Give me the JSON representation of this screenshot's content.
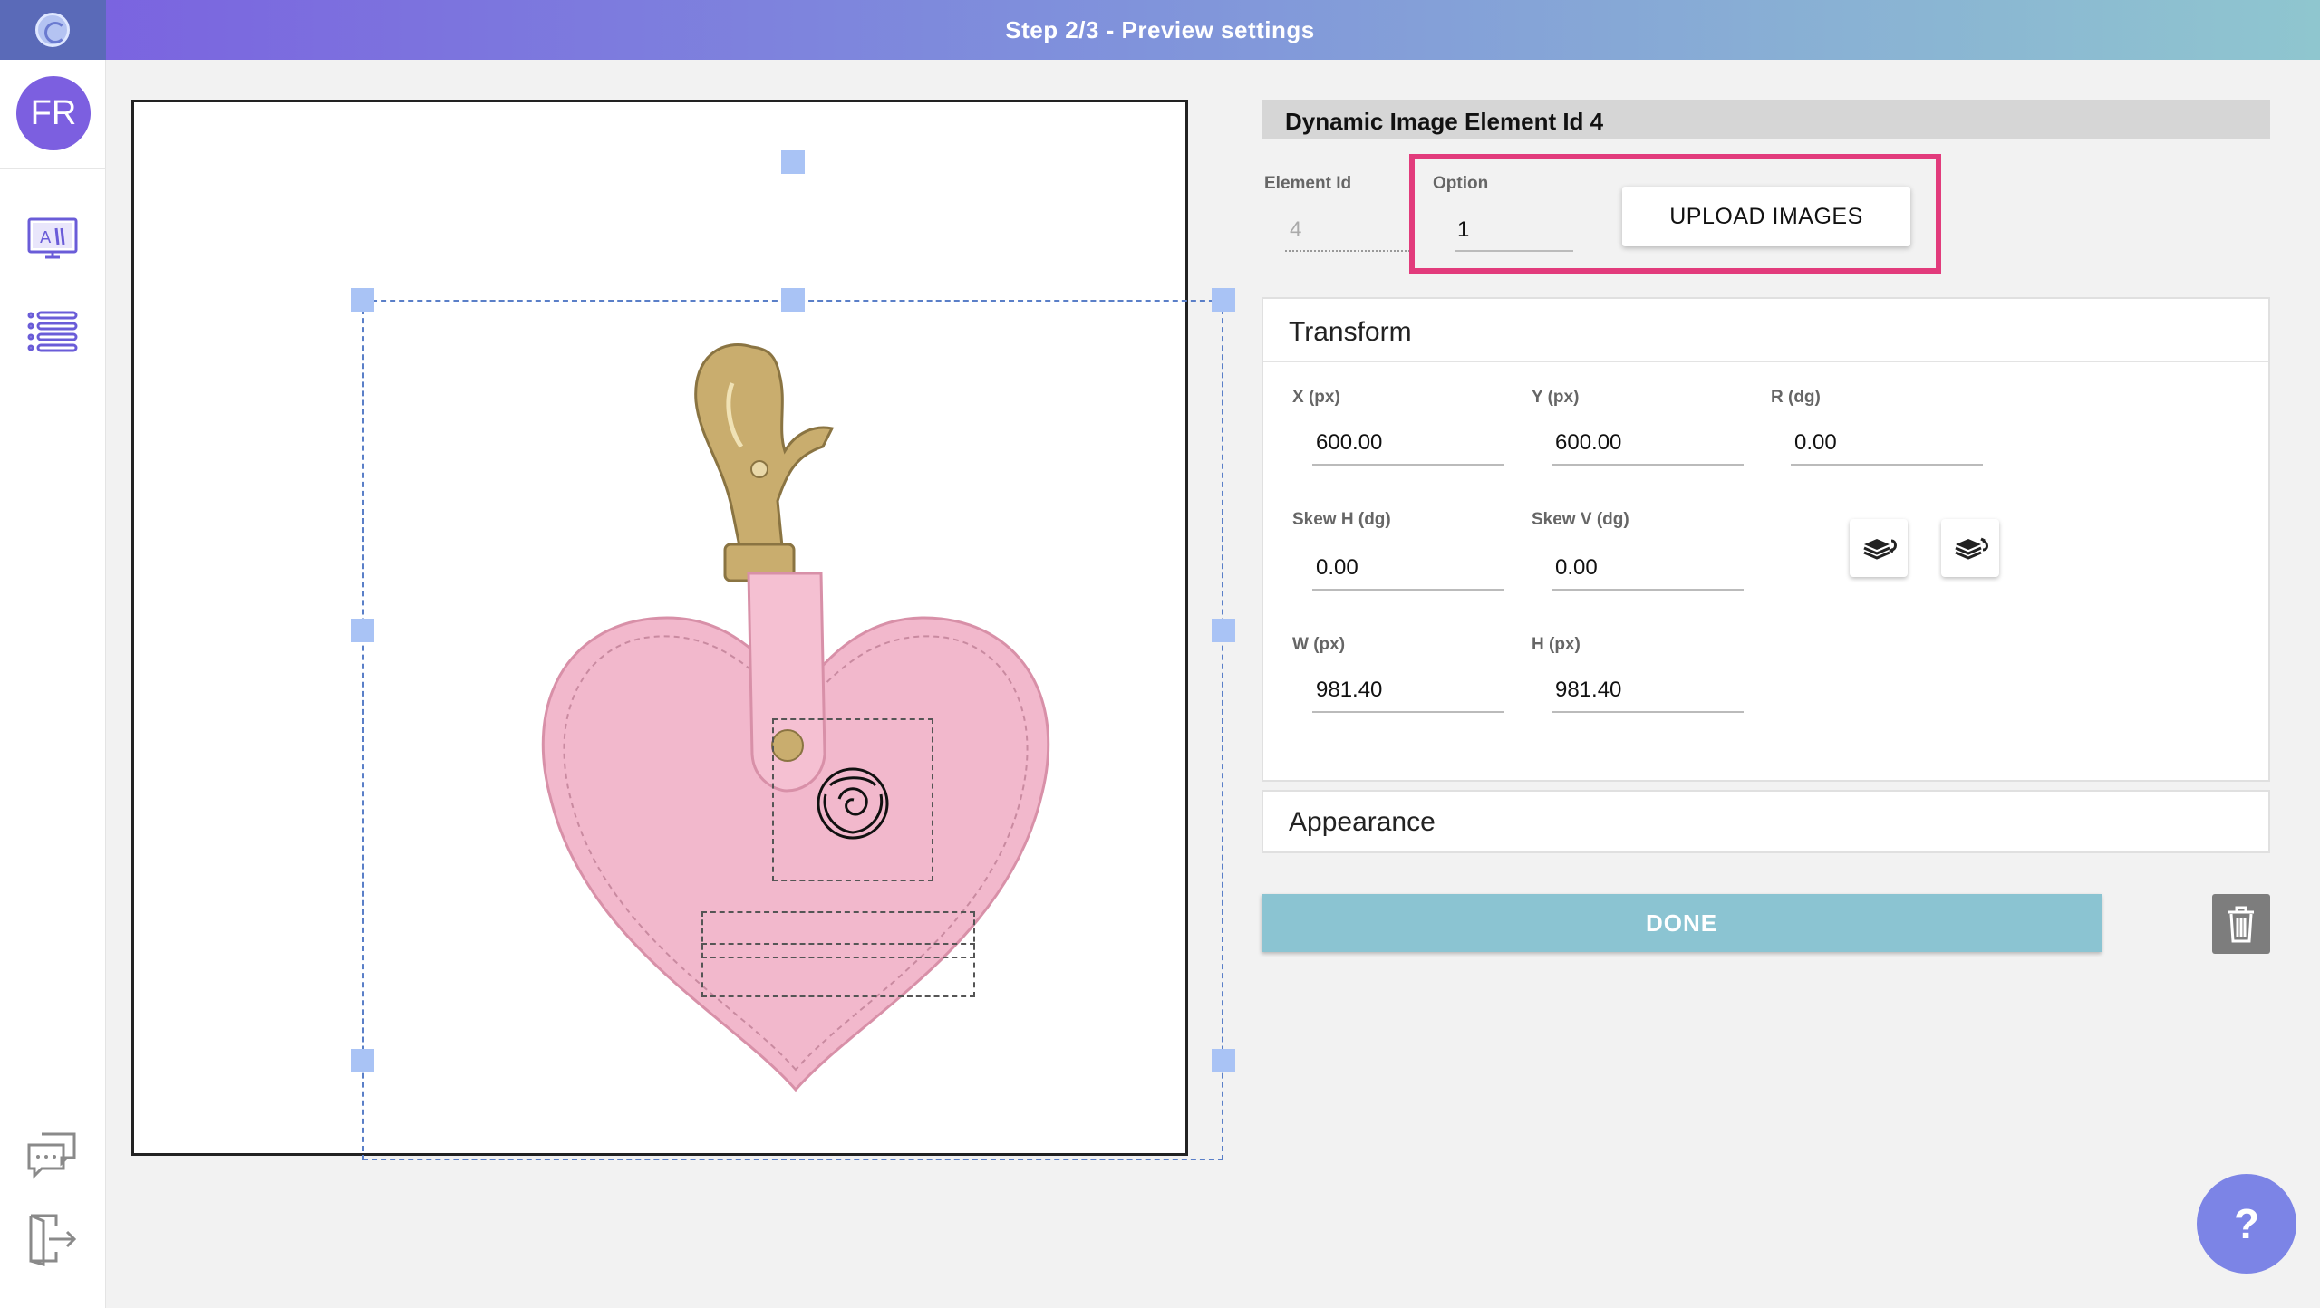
{
  "header": {
    "title": "Step 2/3 - Preview settings"
  },
  "sidebar": {
    "avatar_initials": "FR",
    "items": [
      {
        "icon": "design-monitor-icon"
      },
      {
        "icon": "list-icon"
      },
      {
        "icon": "chat-icon"
      },
      {
        "icon": "exit-door-icon"
      }
    ]
  },
  "panel": {
    "title": "Dynamic Image Element Id 4",
    "element_id": {
      "label": "Element Id",
      "value": "4"
    },
    "option": {
      "label": "Option",
      "value": "1"
    },
    "upload_label": "UPLOAD IMAGES"
  },
  "transform": {
    "title": "Transform",
    "x": {
      "label": "X (px)",
      "value": "600.00"
    },
    "y": {
      "label": "Y (px)",
      "value": "600.00"
    },
    "r": {
      "label": "R (dg)",
      "value": "0.00"
    },
    "skew_h": {
      "label": "Skew H (dg)",
      "value": "0.00"
    },
    "skew_v": {
      "label": "Skew V (dg)",
      "value": "0.00"
    },
    "w": {
      "label": "W (px)",
      "value": "981.40"
    },
    "h": {
      "label": "H (px)",
      "value": "981.40"
    }
  },
  "appearance": {
    "title": "Appearance"
  },
  "actions": {
    "done_label": "DONE",
    "help_label": "?"
  },
  "colors": {
    "accent": "#7c5fe0",
    "done": "#8bc4d2",
    "highlight": "#e23b7c",
    "product_pink": "#f2b8cc"
  }
}
